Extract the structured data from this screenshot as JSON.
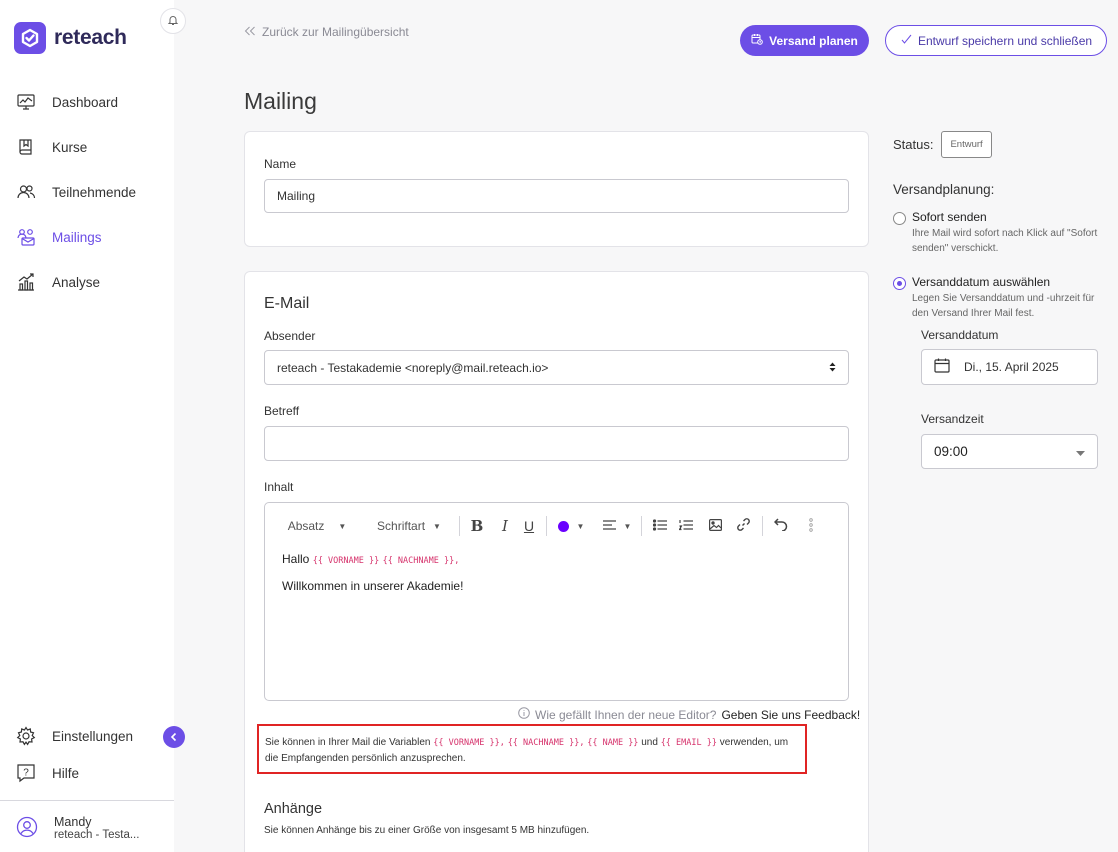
{
  "brand": {
    "name": "reteach",
    "accent": "#6c4ee6",
    "highlight_border": "#e02424",
    "variable_color": "#d6336c"
  },
  "sidebar": {
    "items": [
      {
        "label": "Dashboard",
        "icon": "dashboard-icon"
      },
      {
        "label": "Kurse",
        "icon": "book-icon"
      },
      {
        "label": "Teilnehmende",
        "icon": "users-icon"
      },
      {
        "label": "Mailings",
        "icon": "mailings-icon",
        "active": true
      },
      {
        "label": "Analyse",
        "icon": "analytics-icon"
      }
    ],
    "bottom_items": [
      {
        "label": "Einstellungen",
        "icon": "gear-icon"
      },
      {
        "label": "Hilfe",
        "icon": "help-icon"
      }
    ],
    "user": {
      "name": "Mandy",
      "org": "reteach - Testa..."
    }
  },
  "topbar": {
    "back_label": "Zurück zur Mailingübersicht",
    "schedule_button": "Versand planen",
    "save_close_button": "Entwurf speichern und schließen"
  },
  "page": {
    "title": "Mailing"
  },
  "name_card": {
    "label": "Name",
    "value": "Mailing"
  },
  "email_card": {
    "title": "E-Mail",
    "sender_label": "Absender",
    "sender_value": "reteach - Testakademie <noreply@mail.reteach.io>",
    "subject_label": "Betreff",
    "subject_value": "",
    "content_label": "Inhalt",
    "toolbar": {
      "paragraph": "Absatz",
      "font": "Schriftart"
    },
    "content": {
      "greeting": "Hallo",
      "var_first": "{{ VORNAME }}",
      "var_last": "{{ NACHNAME }}",
      "comma": ",",
      "body": "Willkommen in unserer Akademie!"
    },
    "feedback_question": "Wie gefällt Ihnen der neue Editor?",
    "feedback_link": "Geben Sie uns Feedback!",
    "hint": {
      "before": "Sie können in Ihrer Mail die Variablen",
      "v1": "{{ VORNAME }}",
      "sep": ",",
      "v2": "{{ NACHNAME }}",
      "v3": "{{ NAME }}",
      "and": "und",
      "v4": "{{ EMAIL }}",
      "after": "verwenden, um die Empfangenden persönlich anzusprechen."
    },
    "attachments_title": "Anhänge",
    "attachments_text": "Sie können Anhänge bis zu einer Größe von insgesamt 5 MB hinzufügen."
  },
  "right_panel": {
    "status_label": "Status:",
    "status_value": "Entwurf",
    "planning_title": "Versandplanung:",
    "option_now_title": "Sofort senden",
    "option_now_desc": "Ihre Mail wird sofort nach Klick auf \"Sofort senden\" verschickt.",
    "option_date_title": "Versanddatum auswählen",
    "option_date_desc": "Legen Sie Versanddatum und -uhrzeit für den Versand Ihrer Mail fest.",
    "date_label": "Versanddatum",
    "date_value": "Di., 15. April 2025",
    "time_label": "Versandzeit",
    "time_value": "09:00"
  }
}
